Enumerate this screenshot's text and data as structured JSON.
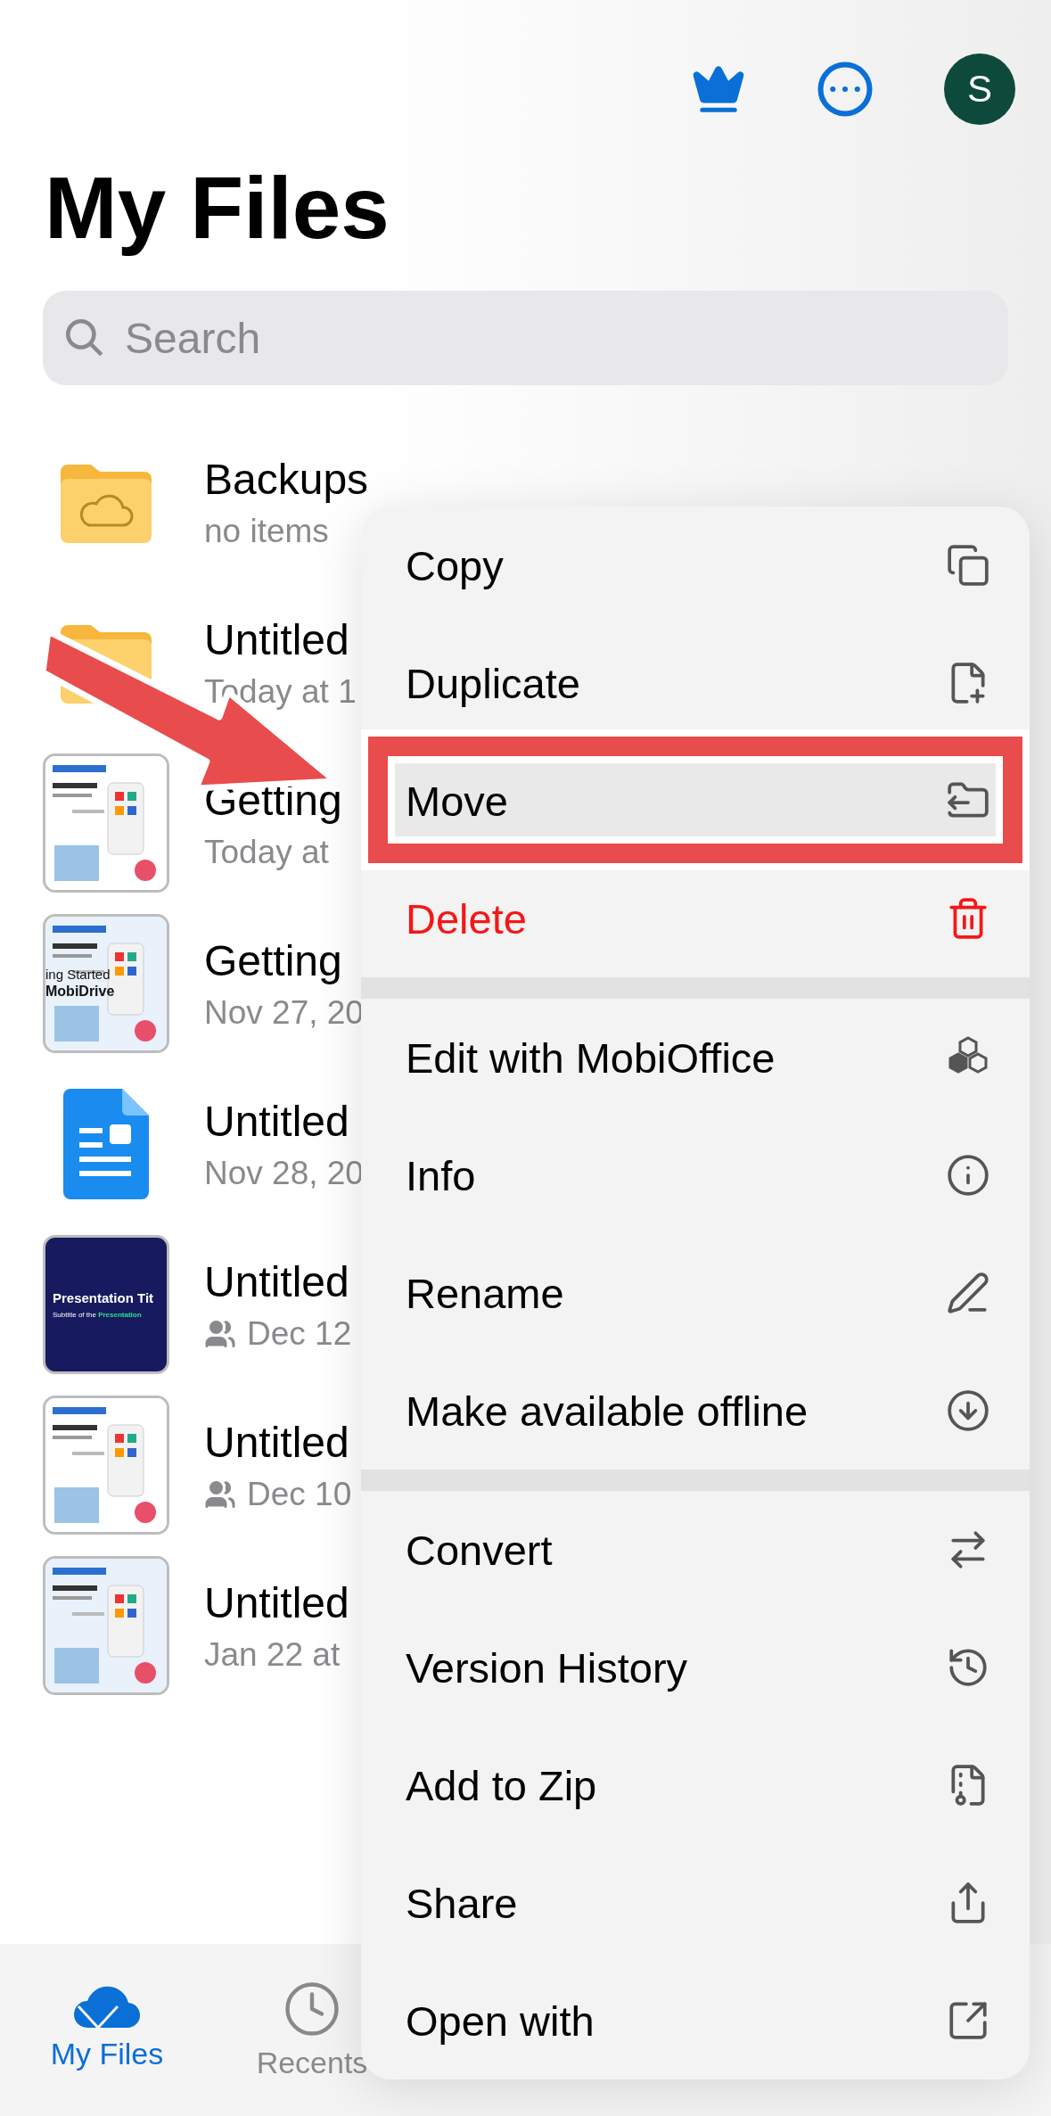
{
  "header": {
    "avatar": "S"
  },
  "title": "My Files",
  "search": {
    "placeholder": "Search"
  },
  "files": [
    {
      "name": "Backups",
      "detail": "no items",
      "thumb": {
        "kind": "cloud-folder"
      },
      "shared": false
    },
    {
      "name": "Untitled",
      "detail": "Today at 1",
      "thumb": {
        "kind": "folder"
      },
      "shared": false
    },
    {
      "name": "Getting",
      "detail": "Today at",
      "shared": false
    },
    {
      "name": "Getting",
      "detail": "Nov 27, 20",
      "thumb": {
        "kind": "promo",
        "lines": [
          "ing Started",
          "MobiDrive"
        ]
      },
      "shared": false
    },
    {
      "name": "Untitled",
      "detail": "Nov 28, 20",
      "thumb": {
        "kind": "document"
      },
      "shared": false
    },
    {
      "name": "Untitled",
      "detail": "Dec 12",
      "thumb": {
        "kind": "slide",
        "lines": [
          "Presentation Tit",
          "Subtitle of the **Presentation**"
        ]
      },
      "shared": true
    },
    {
      "name": "Untitled",
      "detail": "Dec 10",
      "shared": true
    },
    {
      "name": "Untitled",
      "detail": "Jan 22 at",
      "shared": false
    }
  ],
  "menu": {
    "groups": [
      {
        "items": [
          {
            "label": "Copy",
            "selected": false,
            "destructive": false
          },
          {
            "label": "Duplicate",
            "selected": false,
            "destructive": false
          },
          {
            "label": "Move",
            "selected": true,
            "destructive": false
          },
          {
            "label": "Delete",
            "selected": false,
            "destructive": true
          }
        ]
      },
      {
        "items": [
          {
            "label": "Edit with MobiOffice",
            "selected": false,
            "destructive": false
          },
          {
            "label": "Info",
            "selected": false,
            "destructive": false
          },
          {
            "label": "Rename",
            "selected": false,
            "destructive": false
          },
          {
            "label": "Make available offline",
            "selected": false,
            "destructive": false
          }
        ]
      },
      {
        "items": [
          {
            "label": "Convert",
            "selected": false,
            "destructive": false
          },
          {
            "label": "Version History",
            "selected": false,
            "destructive": false
          },
          {
            "label": "Add to Zip",
            "selected": false,
            "destructive": false
          },
          {
            "label": "Share",
            "selected": false,
            "destructive": false
          },
          {
            "label": "Open with",
            "selected": false,
            "destructive": false
          }
        ]
      }
    ]
  },
  "tabs": [
    {
      "label": "My Files",
      "selected": true
    },
    {
      "label": "Recents",
      "selected": false
    }
  ]
}
